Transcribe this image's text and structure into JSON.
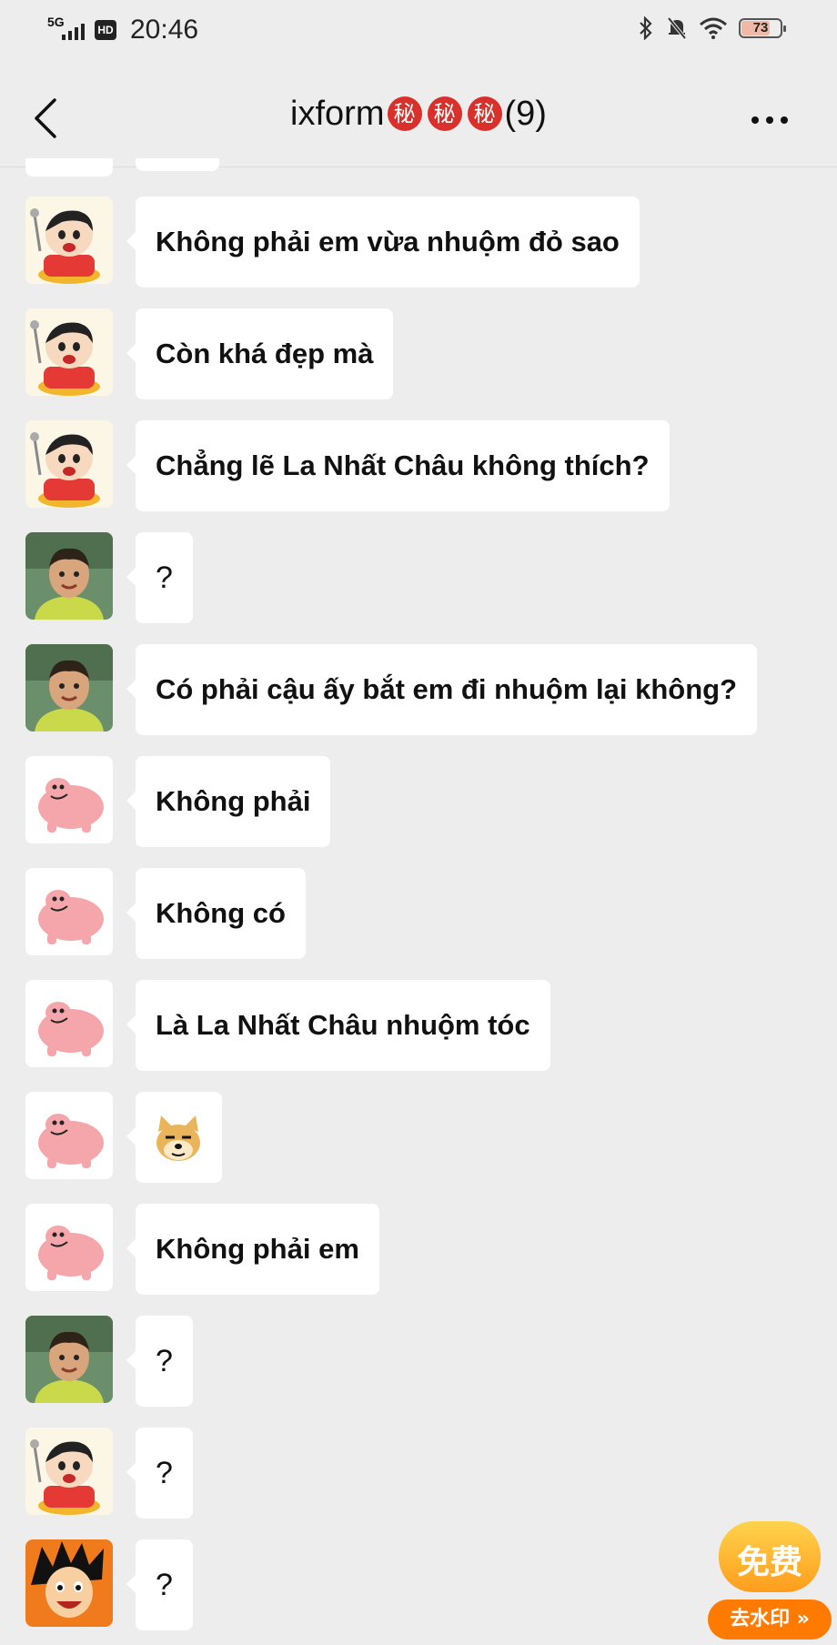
{
  "status_bar": {
    "network": "5G",
    "hd": "HD",
    "time": "20:46",
    "battery": "73",
    "battery_level": 0.73
  },
  "header": {
    "title_prefix": "ixform",
    "title_seals": [
      "秘",
      "秘",
      "秘"
    ],
    "title_count": "(9)"
  },
  "messages": [
    {
      "avatar": "shinchan",
      "text": "Không phải em vừa nhuộm đỏ sao"
    },
    {
      "avatar": "shinchan",
      "text": "Còn khá đẹp mà"
    },
    {
      "avatar": "shinchan",
      "text": "Chẳng lẽ La Nhất Châu không thích?"
    },
    {
      "avatar": "boy",
      "text": "?"
    },
    {
      "avatar": "boy",
      "text": "Có phải cậu ấy bắt em đi nhuộm lại không?"
    },
    {
      "avatar": "pig",
      "text": "Không phải"
    },
    {
      "avatar": "pig",
      "text": "Không có"
    },
    {
      "avatar": "pig",
      "text": "Là La Nhất Châu nhuộm tóc"
    },
    {
      "avatar": "pig",
      "sticker": "doge-sticker"
    },
    {
      "avatar": "pig",
      "text": "Không phải em"
    },
    {
      "avatar": "boy",
      "text": "?"
    },
    {
      "avatar": "shinchan",
      "text": "?"
    },
    {
      "avatar": "goku",
      "text": "?"
    }
  ],
  "watermark_badge": {
    "top": "免费",
    "bottom": "去水印 »"
  },
  "colors": {
    "background": "#ededed",
    "bubble": "#ffffff",
    "seal": "#d9302b",
    "badge_orange": "#ff7a00"
  }
}
